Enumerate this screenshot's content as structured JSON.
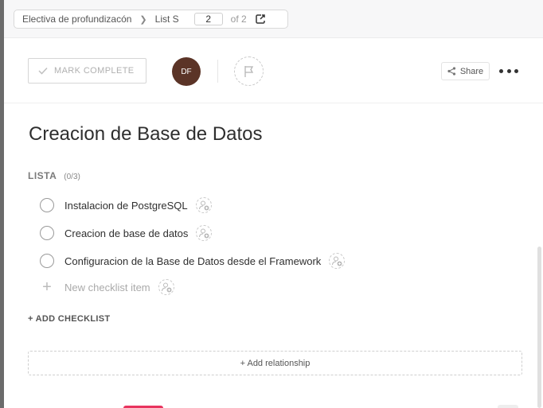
{
  "breadcrumb": {
    "space": "Electiva de profundizacón",
    "list": "List S",
    "page_value": "2",
    "of_label": "of 2"
  },
  "toolbar": {
    "mark_complete": "MARK COMPLETE",
    "avatar_initials": "DF",
    "avatar_color": "#5b3427",
    "share": "Share"
  },
  "task": {
    "title": "Creacion de Base de Datos"
  },
  "checklist": {
    "name": "LISTA",
    "count": "(0/3)",
    "items": [
      {
        "label": "Instalacion de PostgreSQL"
      },
      {
        "label": "Creacion de base de datos"
      },
      {
        "label": "Configuracion de la Base de Datos desde el Framework"
      }
    ],
    "new_item_placeholder": "New checklist item"
  },
  "add_checklist": "+ ADD CHECKLIST",
  "add_relationship": "+ Add relationship"
}
